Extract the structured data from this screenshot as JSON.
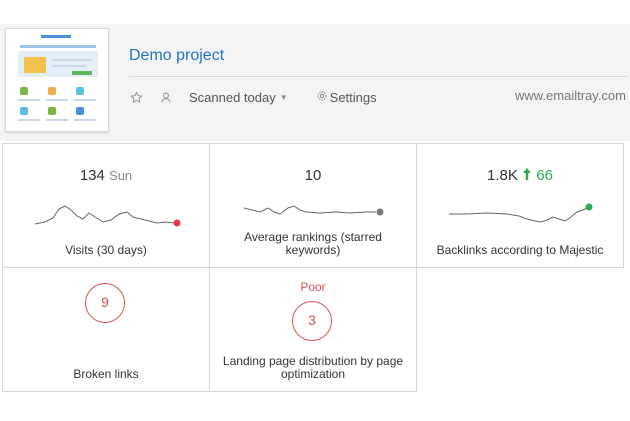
{
  "project": {
    "title": "Demo project",
    "scanned_label": "Scanned today",
    "settings_label": "Settings",
    "site": "www.emailtray.com"
  },
  "cards": {
    "visits": {
      "value": "134",
      "suffix": "Sun",
      "label": "Visits (30 days)",
      "dot_color": "#e8334a"
    },
    "rankings": {
      "value": "10",
      "label": "Average rankings (starred keywords)",
      "dot_color": "#777777"
    },
    "backlinks": {
      "value": "1.8K",
      "delta": "66",
      "label": "Backlinks according to Majestic",
      "dot_color": "#2daa52"
    },
    "broken": {
      "value": "9",
      "label": "Broken links"
    },
    "landing": {
      "status": "Poor",
      "value": "3",
      "label": "Landing page distribution by page optimization"
    }
  },
  "colors": {
    "link": "#1f73c6",
    "alert": "#d9534f",
    "positive": "#2daa52"
  },
  "icons": [
    "star-icon",
    "user-icon",
    "chevron-down-icon",
    "gear-icon",
    "arrow-up-icon"
  ]
}
